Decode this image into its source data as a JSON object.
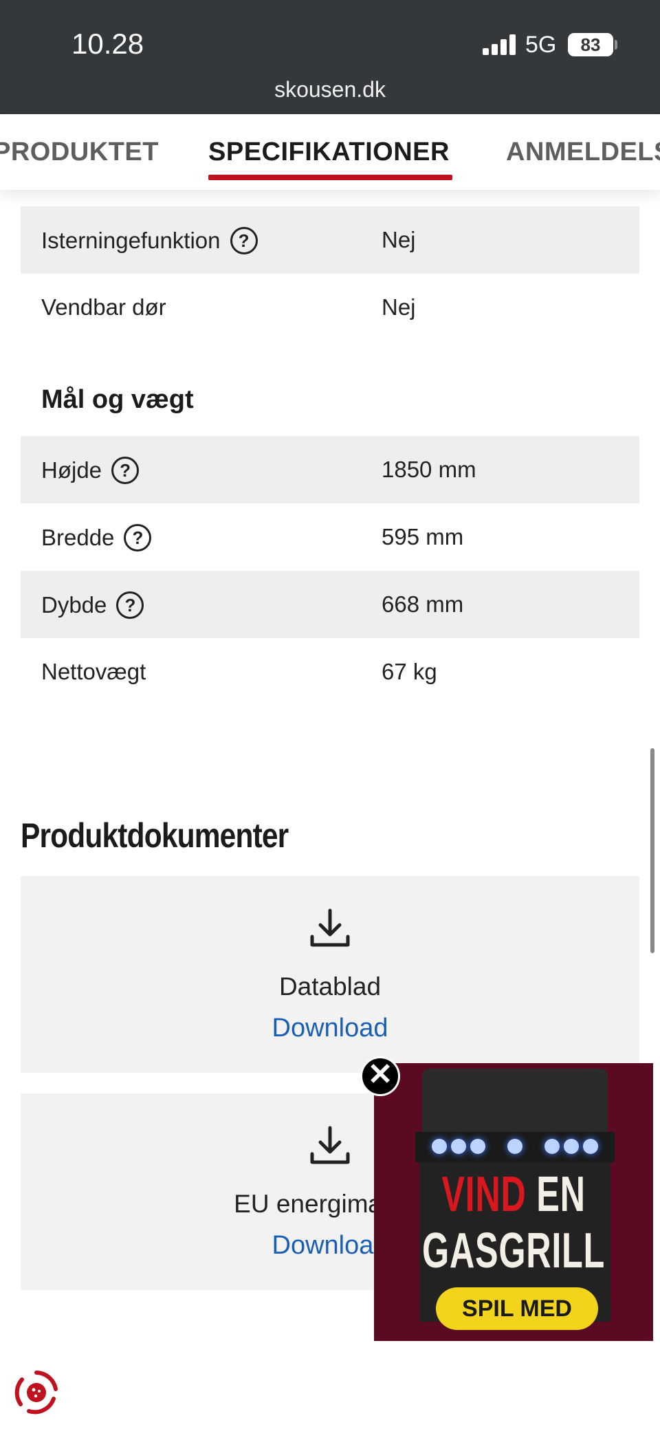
{
  "status_bar": {
    "time": "10.28",
    "network": "5G",
    "battery": "83",
    "url": "skousen.dk"
  },
  "tabs": [
    {
      "label": "PRODUKTET",
      "active": false
    },
    {
      "label": "SPECIFIKATIONER",
      "active": true
    },
    {
      "label": "ANMELDELSER",
      "active": false
    }
  ],
  "specs_top": [
    {
      "label": "Isterningefunktion",
      "value": "Nej",
      "help": true
    },
    {
      "label": "Vendbar dør",
      "value": "Nej",
      "help": false
    }
  ],
  "dimensions": {
    "title": "Mål og vægt",
    "rows": [
      {
        "label": "Højde",
        "value": "1850 mm",
        "help": true
      },
      {
        "label": "Bredde",
        "value": "595 mm",
        "help": true
      },
      {
        "label": "Dybde",
        "value": "668 mm",
        "help": true
      },
      {
        "label": "Nettovægt",
        "value": "67 kg",
        "help": false
      }
    ]
  },
  "documents": {
    "title": "Produktdokumenter",
    "items": [
      {
        "name": "Datablad",
        "link": "Download"
      },
      {
        "name": "EU energimærke",
        "link": "Download"
      }
    ]
  },
  "ad": {
    "line1_red": "VIND",
    "line1_white": "EN",
    "line2": "GASGRILL",
    "button": "SPIL MED",
    "close": "✕"
  },
  "colors": {
    "accent": "#c0121e",
    "link": "#1a5fb4",
    "ad_bg": "#5a0b22",
    "ad_button": "#f2d41c"
  }
}
